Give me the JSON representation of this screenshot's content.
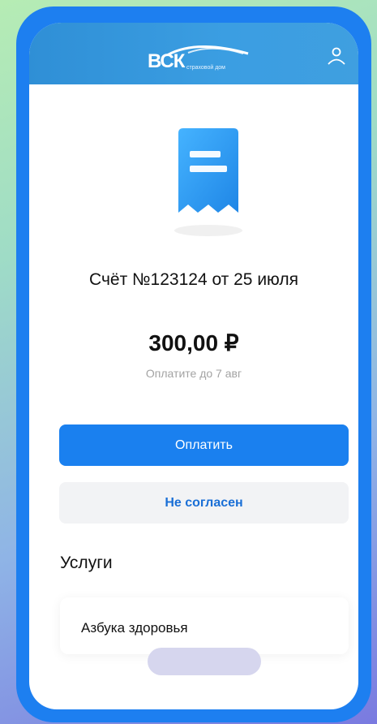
{
  "header": {
    "logo_text": "ВСК",
    "logo_subtext": "страховой дом",
    "profile_icon": "user-icon"
  },
  "invoice": {
    "receipt_icon": "receipt-icon",
    "title": "Счёт №123124 от 25 июля",
    "amount": "300,00 ₽",
    "due_text": "Оплатите до 7 авг"
  },
  "actions": {
    "pay_label": "Оплатить",
    "reject_label": "Не согласен"
  },
  "services": {
    "title": "Услуги",
    "items": [
      {
        "name": "Азбука здоровья"
      }
    ]
  },
  "colors": {
    "header": "#3b9ee2",
    "primary_button": "#1a80ef",
    "secondary_button_bg": "#f2f3f5",
    "secondary_button_text": "#1a6fd6",
    "phone_frame": "#1d7ff0"
  }
}
